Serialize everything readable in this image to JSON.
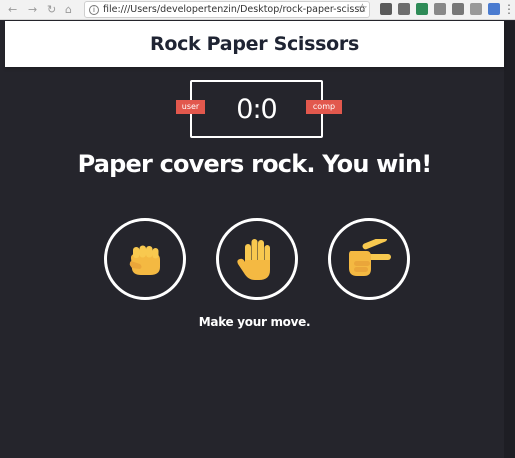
{
  "browser": {
    "url": "file:///Users/developertenzin/Desktop/rock-paper-scisso...",
    "icons": [
      "back-icon",
      "forward-icon",
      "reload-icon",
      "home-icon",
      "info-icon",
      "star-icon",
      "menu-icon"
    ]
  },
  "header": {
    "title": "Rock Paper Scissors"
  },
  "scoreboard": {
    "user_label": "user",
    "comp_label": "comp",
    "score": "0:0"
  },
  "result": "Paper covers rock. You win!",
  "choices": [
    {
      "id": "rock",
      "icon": "fist-icon"
    },
    {
      "id": "paper",
      "icon": "open-hand-icon"
    },
    {
      "id": "scissors",
      "icon": "peace-hand-icon"
    }
  ],
  "prompt": "Make your move.",
  "colors": {
    "background": "#25252c",
    "header": "#ffffff",
    "badge": "#e2584d",
    "hand": "#f4b942"
  }
}
